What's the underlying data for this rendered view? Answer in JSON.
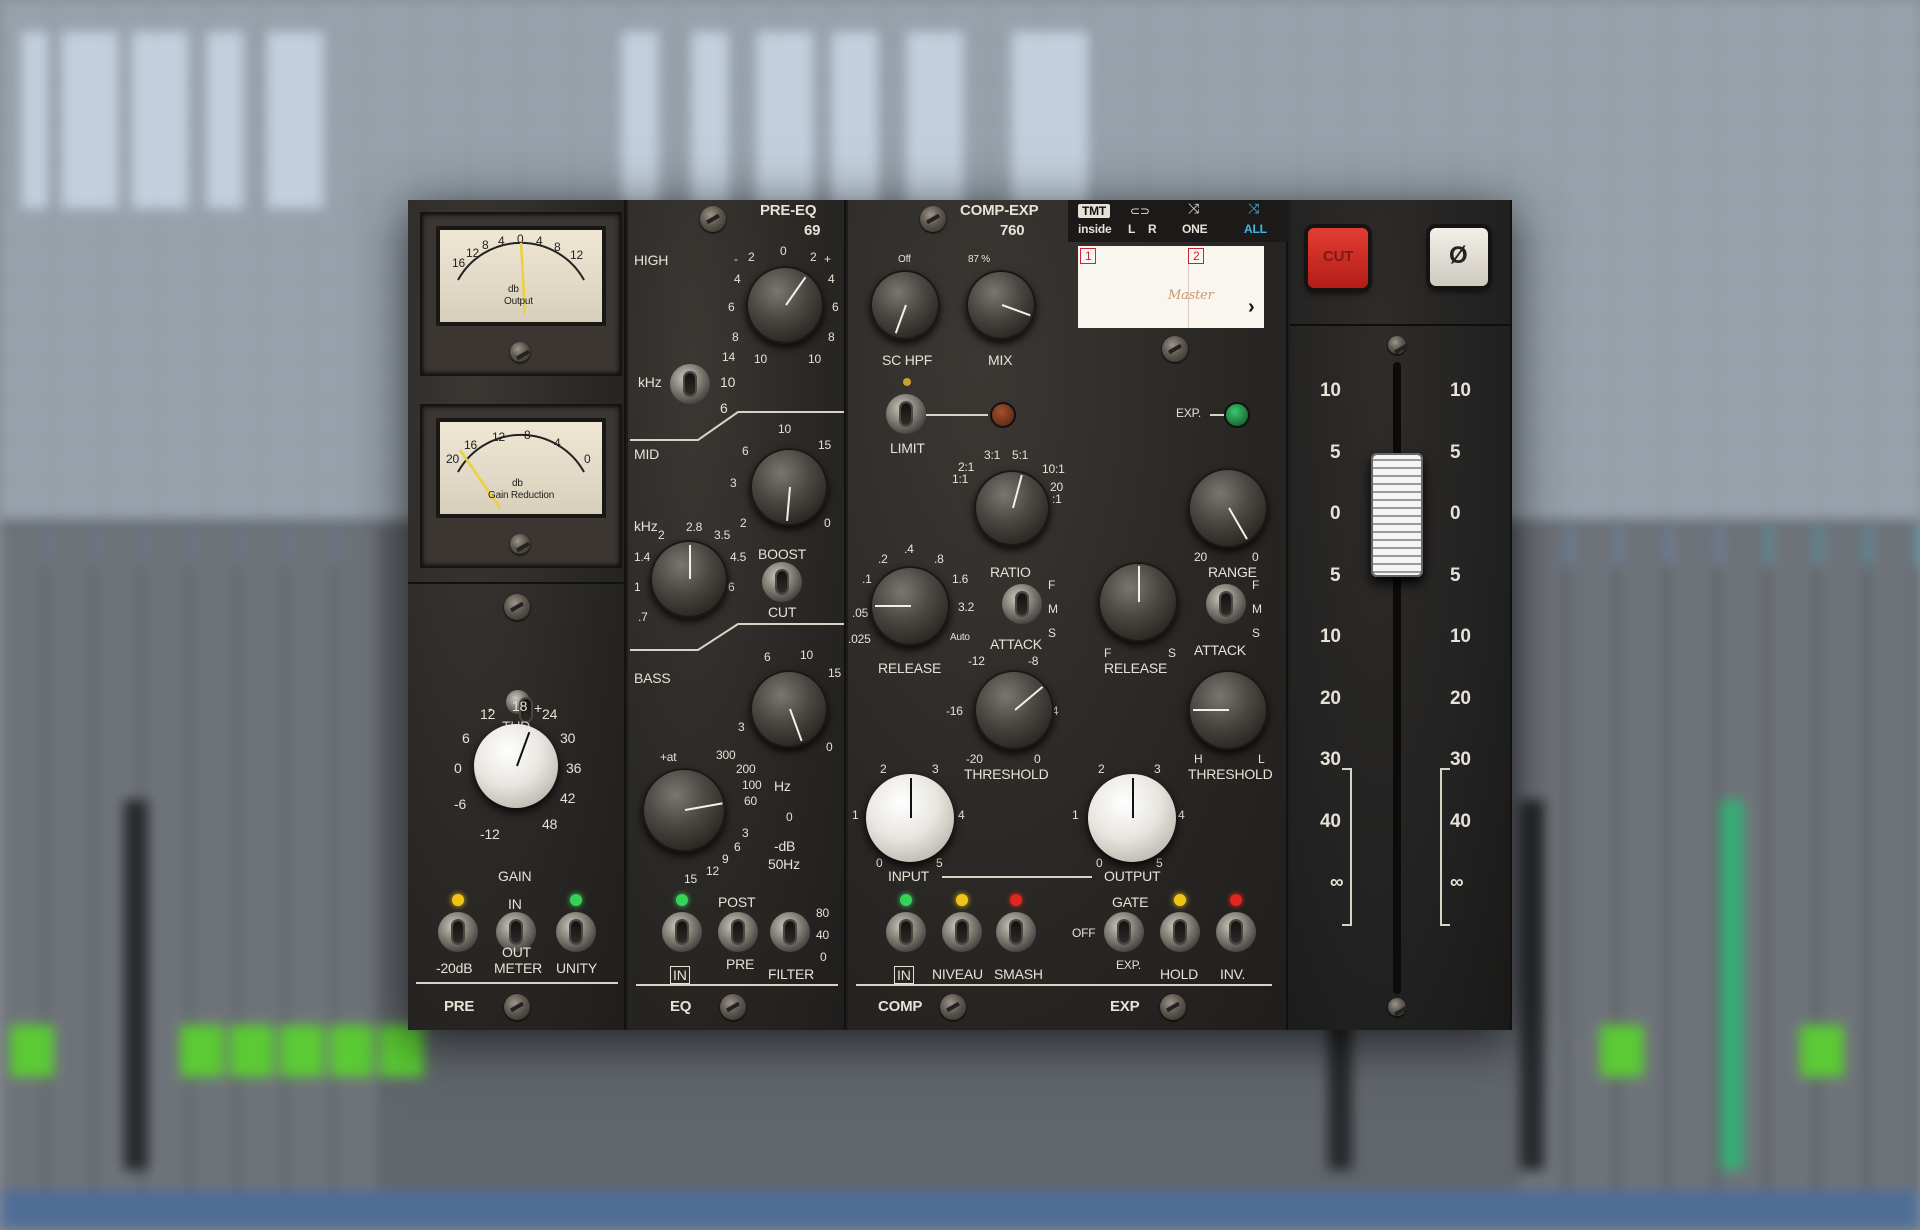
{
  "pre": {
    "meter1": {
      "unit": "db",
      "label": "Output",
      "scale": [
        "16",
        "12",
        "8",
        "4",
        "0",
        "4",
        "8",
        "12"
      ],
      "minus": "-",
      "plus": "+"
    },
    "meter2": {
      "unit": "db",
      "label": "Gain Reduction",
      "scale": [
        "20",
        "16",
        "12",
        "8",
        "4",
        "0"
      ]
    },
    "thd": {
      "label": "THD",
      "minus": "-",
      "plus": "+"
    },
    "gain": {
      "label": "GAIN",
      "scale": [
        "-12",
        "-6",
        "0",
        "6",
        "12",
        "18",
        "24",
        "30",
        "36",
        "42",
        "48"
      ]
    },
    "switches": {
      "s1": "-20dB",
      "s2_top": "IN",
      "s2_bottom": "OUT",
      "s2_sub": "METER",
      "s3": "UNITY"
    },
    "footer": "PRE"
  },
  "eq": {
    "title": "PRE-EQ",
    "model": "69",
    "high": {
      "label": "HIGH",
      "scale": [
        "-",
        "2",
        "0",
        "2",
        "+",
        "4",
        "4",
        "6",
        "6",
        "8",
        "8",
        "10",
        "10",
        "14"
      ],
      "khz": "kHz",
      "sw": [
        "10",
        "6"
      ]
    },
    "mid": {
      "label": "MID",
      "scale": [
        "6",
        "10",
        "15",
        "3",
        "2",
        "0"
      ],
      "khz": "kHz",
      "freq": [
        "2",
        "2.8",
        "3.5",
        "1.4",
        "4.5",
        "1",
        "6",
        ".7"
      ],
      "boost": "BOOST",
      "cut": "CUT"
    },
    "bass": {
      "label": "BASS",
      "scale": [
        "6",
        "10",
        "15",
        "3",
        "0"
      ],
      "freq": [
        "+at",
        "300",
        "200",
        "100",
        "60",
        "0",
        "3",
        "6",
        "9",
        "12",
        "15"
      ],
      "hz": "Hz",
      "db": "-dB",
      "hz50": "50Hz"
    },
    "switches": {
      "in": "IN",
      "post": "POST",
      "pre": "PRE",
      "filter": "FILTER",
      "filter_scale": [
        "80",
        "40",
        "0"
      ]
    },
    "footer": "EQ"
  },
  "comp": {
    "title": "COMP-EXP",
    "model": "760",
    "tabs": {
      "brand_top": "TMT",
      "brand_bottom": "inside",
      "l": "L",
      "r": "R",
      "one": "ONE",
      "all": "ALL"
    },
    "display": {
      "slot1": "1",
      "slot2": "2",
      "name": "Master",
      "arrow": "›"
    },
    "sc_hpf": {
      "label": "SC HPF",
      "value": "Off"
    },
    "mix": {
      "label": "MIX",
      "value": "87 %"
    },
    "limit": "LIMIT",
    "exp_led": "EXP.",
    "ratio": {
      "label": "RATIO",
      "scale": [
        "1:1",
        "2:1",
        "3:1",
        "5:1",
        "10:1",
        "20",
        ":1"
      ]
    },
    "release": {
      "label": "RELEASE",
      "scale": [
        ".2",
        ".4",
        ".8",
        "1.6",
        "3.2",
        ".1",
        ".05",
        ".025",
        "Auto"
      ]
    },
    "attack": {
      "label": "ATTACK",
      "f": "F",
      "m": "M",
      "s": "S"
    },
    "threshold": {
      "label": "THRESHOLD",
      "scale": [
        "-12",
        "-8",
        "-16",
        "-4",
        "-20",
        "0"
      ]
    },
    "input": {
      "label": "INPUT",
      "scale": [
        "2",
        "3",
        "1",
        "4",
        "0",
        "5"
      ]
    },
    "output": {
      "label": "OUTPUT",
      "scale": [
        "2",
        "3",
        "1",
        "4",
        "0",
        "5"
      ]
    },
    "switches": {
      "in": "IN",
      "niveau": "NIVEAU",
      "smash": "SMASH"
    },
    "footer": "COMP"
  },
  "exp": {
    "range": {
      "label": "RANGE",
      "scale": [
        "20",
        "0"
      ]
    },
    "release": {
      "label": "RELEASE",
      "f": "F",
      "s": "S"
    },
    "attack": {
      "label": "ATTACK",
      "f": "F",
      "m": "M",
      "s": "S"
    },
    "threshold": {
      "label": "THRESHOLD",
      "h": "H",
      "l": "L"
    },
    "switches": {
      "gate": "GATE",
      "off": "OFF",
      "exp": "EXP.",
      "hold": "HOLD",
      "inv": "INV."
    },
    "footer": "EXP"
  },
  "out": {
    "cut": "CUT",
    "phase": "Ø",
    "scale": [
      "10",
      "5",
      "0",
      "5",
      "10",
      "20",
      "30",
      "40",
      "∞"
    ],
    "fader_level_db": 0
  }
}
